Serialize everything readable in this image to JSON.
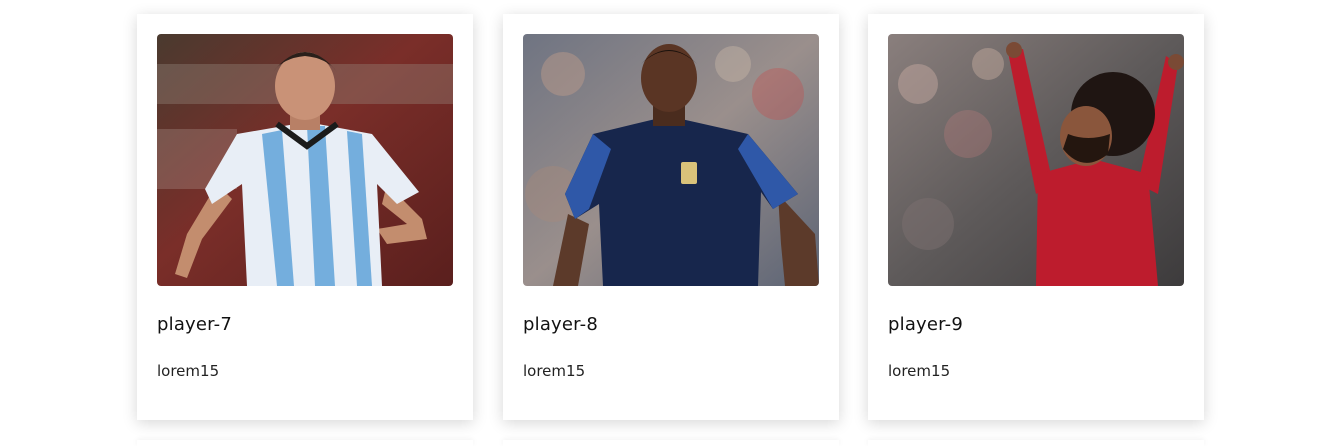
{
  "cards": [
    {
      "title": "player-7",
      "text": "lorem15",
      "image": "player-photo-argentina",
      "colors": {
        "background": "#6e2a26",
        "kit_primary": "#e8eef6",
        "kit_stripe": "#74aedd"
      }
    },
    {
      "title": "player-8",
      "text": "lorem15",
      "image": "player-photo-france",
      "colors": {
        "background": "#8a8f99",
        "kit_primary": "#17264c",
        "kit_accent": "#2f58a8"
      }
    },
    {
      "title": "player-9",
      "text": "lorem15",
      "image": "player-photo-liverpool",
      "colors": {
        "background": "#6d6a69",
        "kit_primary": "#bd1c2d"
      }
    }
  ]
}
